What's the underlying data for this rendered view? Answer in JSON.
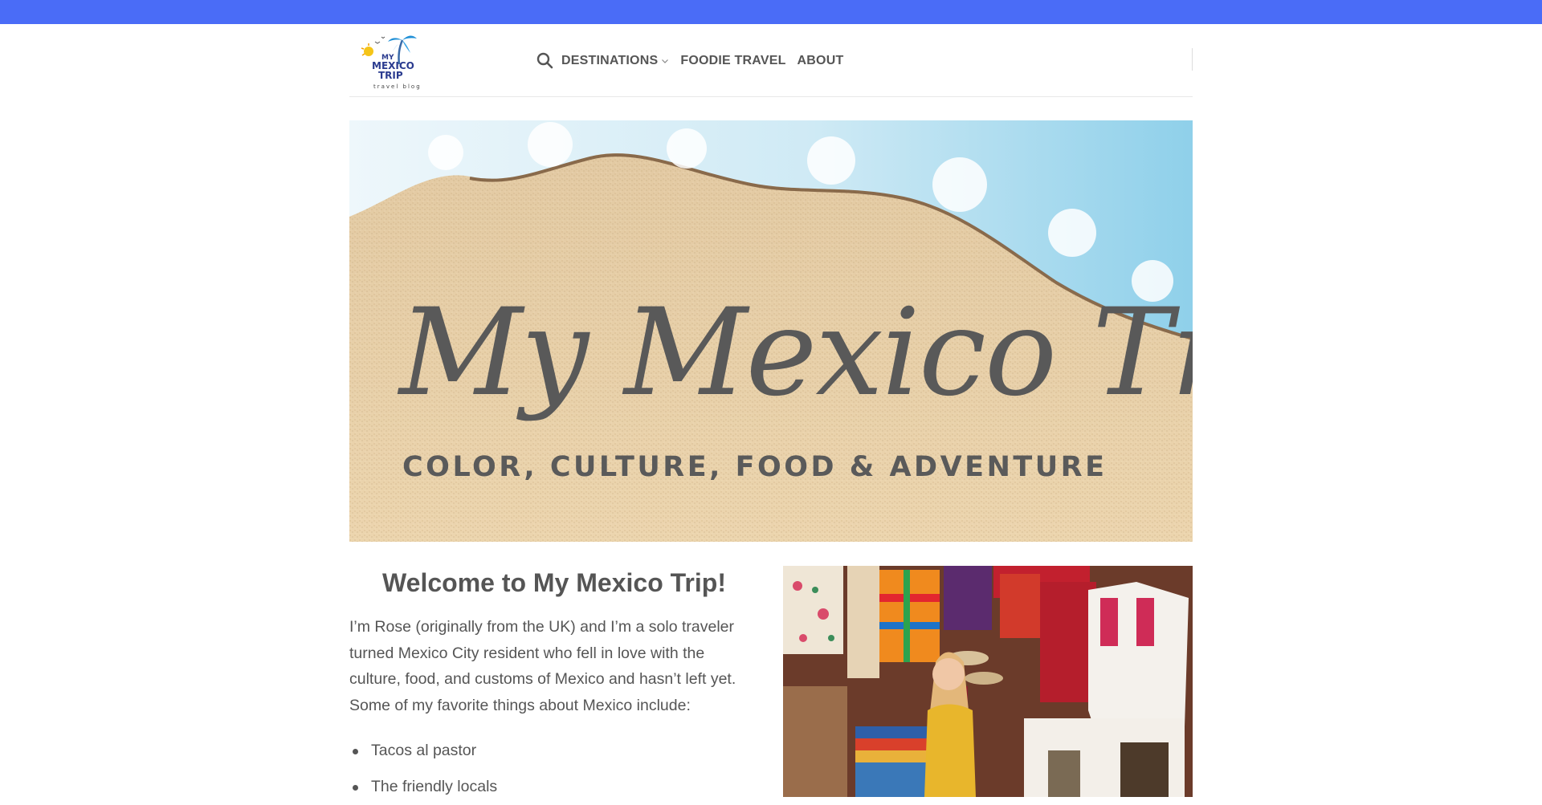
{
  "header": {
    "logo": {
      "line1": "MY",
      "line2": "MEXICO",
      "line3": "TRIP",
      "line4": "travel blog"
    },
    "nav": [
      {
        "label": "DESTINATIONS",
        "has_dropdown": true
      },
      {
        "label": "FOODIE TRAVEL",
        "has_dropdown": false
      },
      {
        "label": "ABOUT",
        "has_dropdown": false
      }
    ],
    "search_icon": "search-icon",
    "colors": {
      "top_strip": "#4a6cf7",
      "nav_text": "#555555"
    }
  },
  "hero": {
    "title": "My Mexico Trip",
    "tagline": "COLOR, CULTURE, FOOD & ADVENTURE"
  },
  "welcome": {
    "title": "Welcome to My Mexico Trip!",
    "intro": "I’m Rose (originally from the UK) and I’m a solo traveler turned Mexico City resident who fell in love with the culture, food, and customs of Mexico and hasn’t left yet. Some of my favorite things about Mexico include:",
    "favorites": [
      "Tacos al pastor",
      "The friendly locals"
    ]
  }
}
